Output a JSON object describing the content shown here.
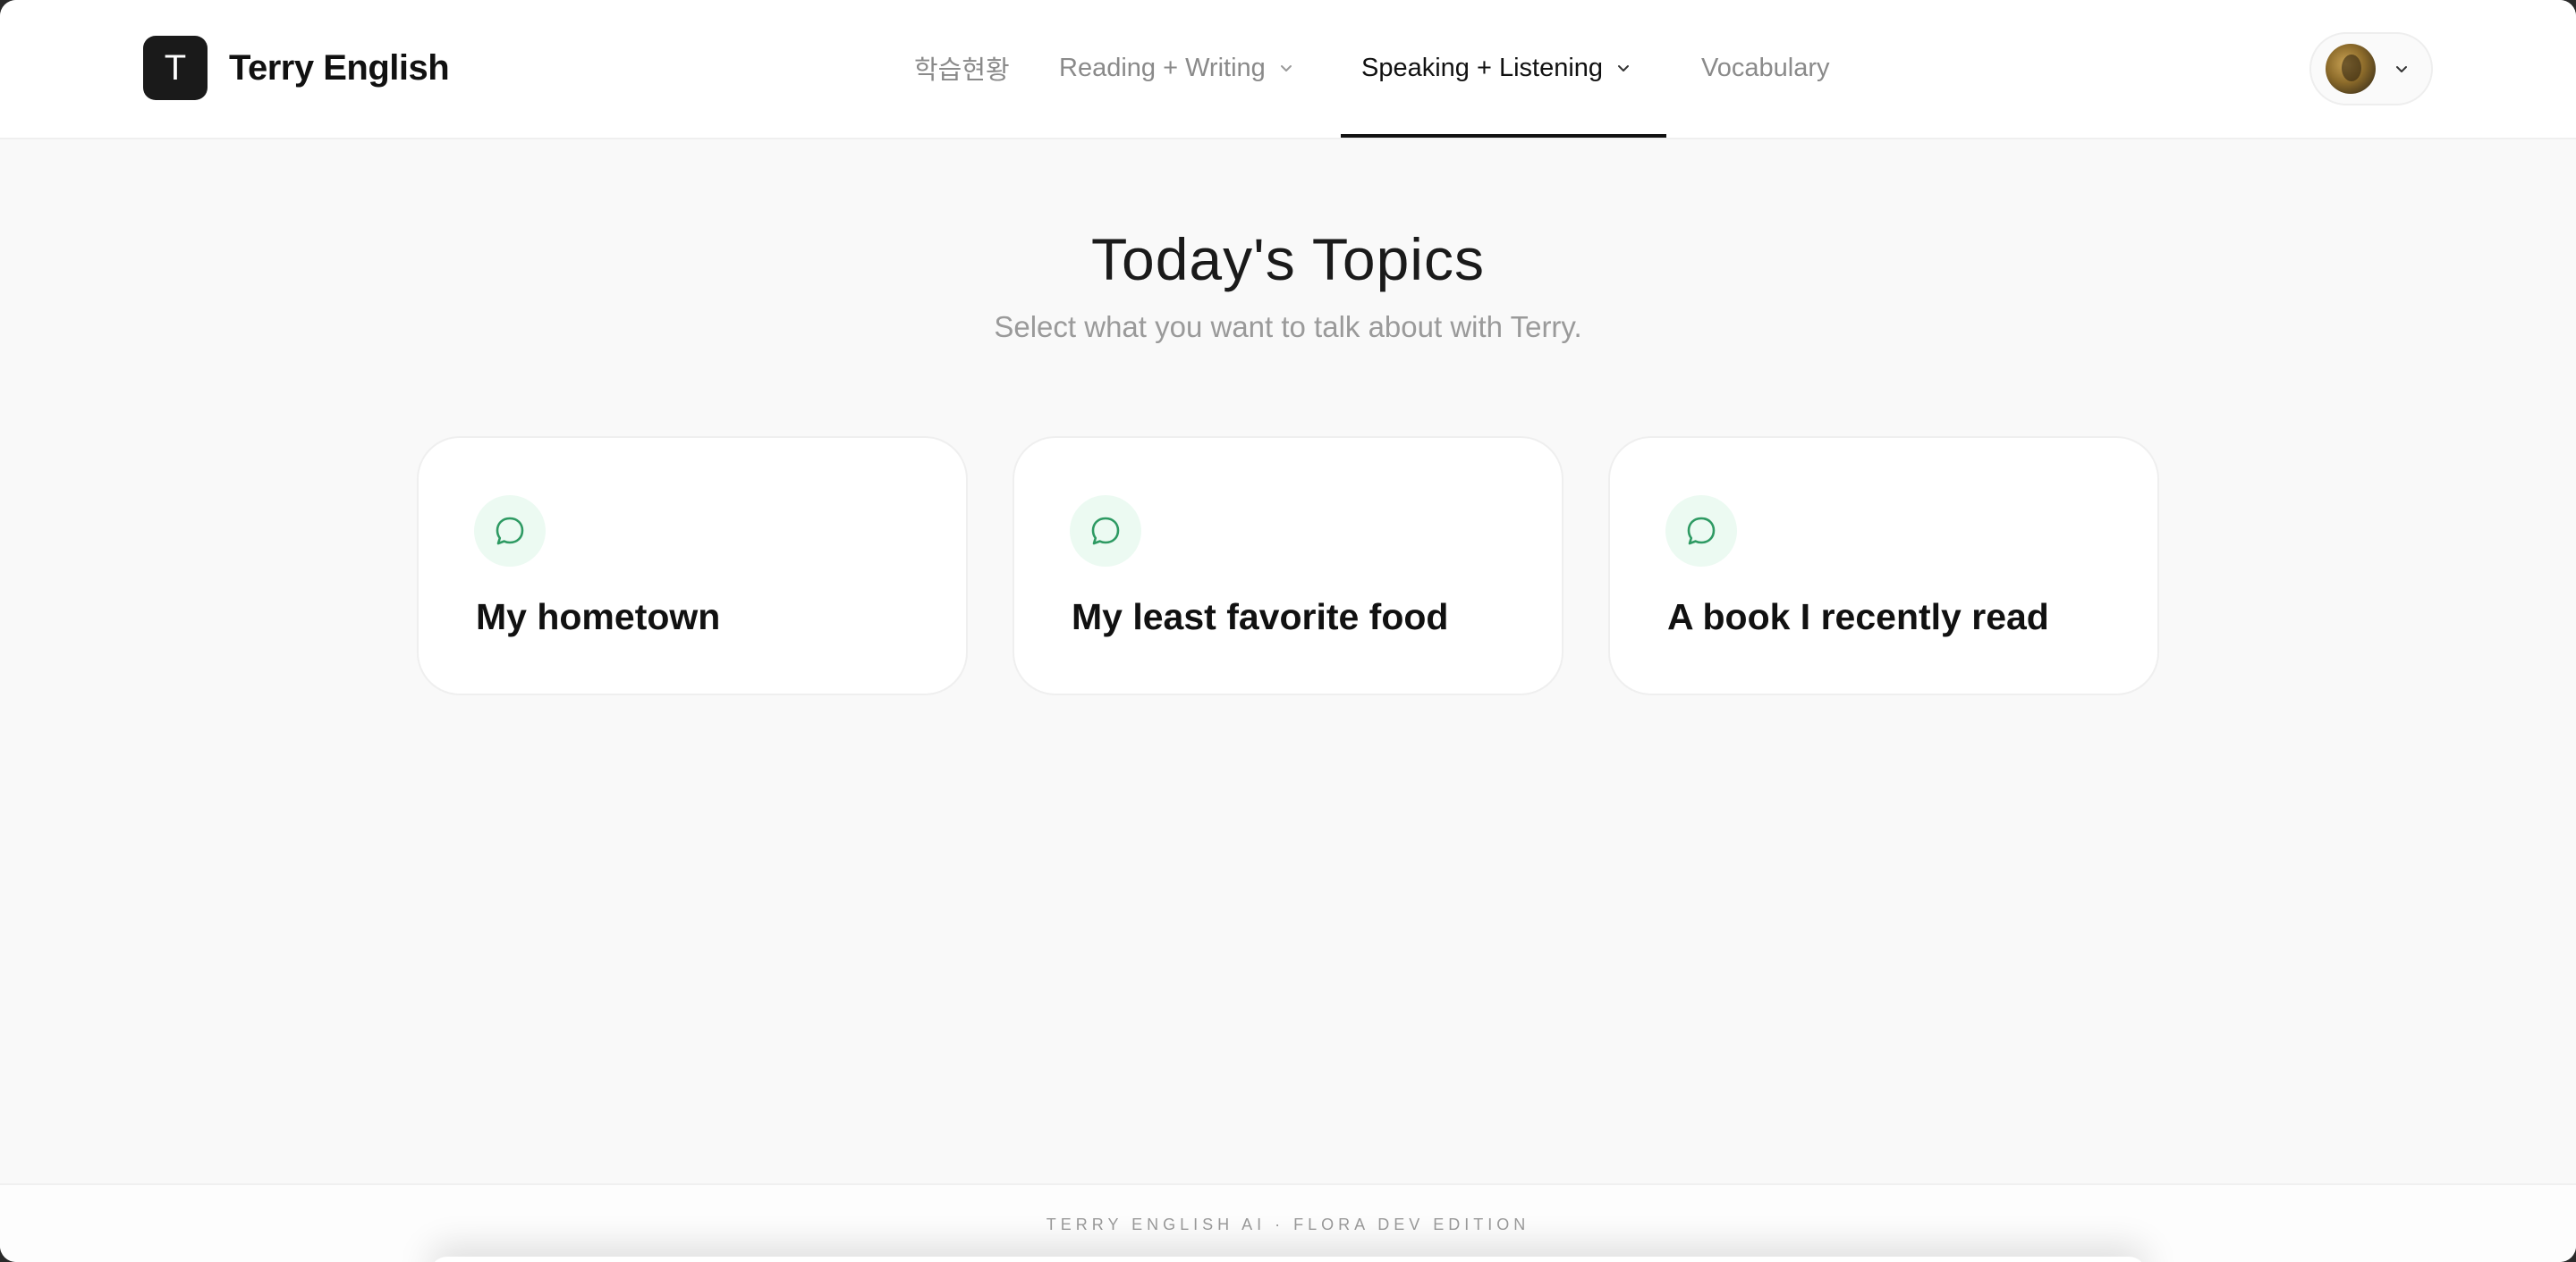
{
  "header": {
    "logo_letter": "T",
    "brand": "Terry English",
    "nav": [
      {
        "label": "학습현황",
        "has_dropdown": false,
        "active": false
      },
      {
        "label": "Reading + Writing",
        "has_dropdown": true,
        "active": false
      },
      {
        "label": "Speaking + Listening",
        "has_dropdown": true,
        "active": true
      },
      {
        "label": "Vocabulary",
        "has_dropdown": false,
        "active": false
      }
    ]
  },
  "main": {
    "title": "Today's Topics",
    "subtitle": "Select what you want to talk about with Terry.",
    "topics": [
      {
        "icon": "chat-bubble-icon",
        "title": "My hometown"
      },
      {
        "icon": "chat-bubble-icon",
        "title": "My least favorite food"
      },
      {
        "icon": "chat-bubble-icon",
        "title": "A book I recently read"
      }
    ]
  },
  "footer": {
    "text": "TERRY ENGLISH AI · FLORA DEV EDITION"
  },
  "colors": {
    "accent_green": "#2e9a63",
    "icon_bg": "#ecfaf2",
    "text_dark": "#111111",
    "text_muted": "#9a9a9a"
  }
}
